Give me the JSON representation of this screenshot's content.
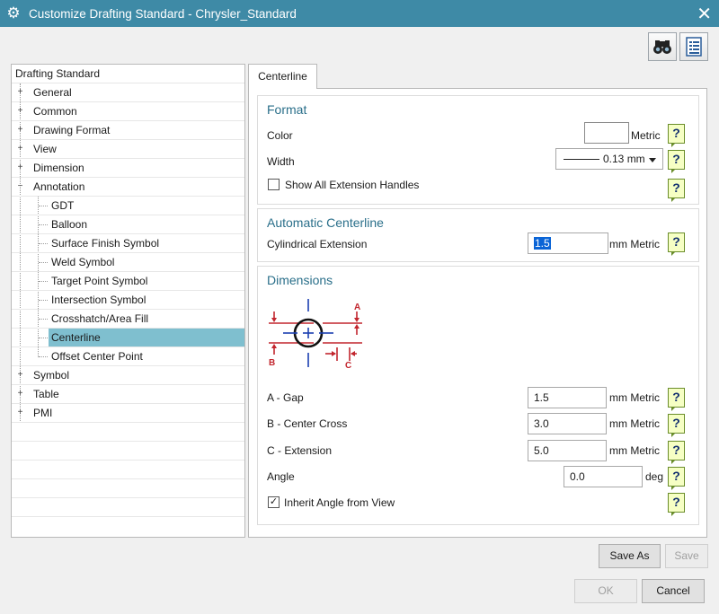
{
  "window": {
    "title": "Customize Drafting Standard - Chrysler_Standard",
    "icon": "gear-icon",
    "close": "✕"
  },
  "toolbar": {
    "find_icon": "binoculars-icon",
    "info_icon": "info-list-icon"
  },
  "tree": {
    "header": "Drafting Standard",
    "items": [
      {
        "label": "General",
        "expander": "+"
      },
      {
        "label": "Common",
        "expander": "+"
      },
      {
        "label": "Drawing Format",
        "expander": "+"
      },
      {
        "label": "View",
        "expander": "+"
      },
      {
        "label": "Dimension",
        "expander": "+"
      },
      {
        "label": "Annotation",
        "expander": "−"
      },
      {
        "label": "GDT"
      },
      {
        "label": "Balloon"
      },
      {
        "label": "Surface Finish Symbol"
      },
      {
        "label": "Weld Symbol"
      },
      {
        "label": "Target Point Symbol"
      },
      {
        "label": "Intersection Symbol"
      },
      {
        "label": "Crosshatch/Area Fill"
      },
      {
        "label": "Centerline",
        "selected": true
      },
      {
        "label": "Offset Center Point"
      },
      {
        "label": "Symbol",
        "expander": "+"
      },
      {
        "label": "Table",
        "expander": "+"
      },
      {
        "label": "PMI",
        "expander": "+"
      }
    ]
  },
  "tab": {
    "label": "Centerline"
  },
  "format": {
    "title": "Format",
    "color_label": "Color",
    "color_value": "#ffffff",
    "color_unit": "Metric",
    "width_label": "Width",
    "width_value": "0.13 mm",
    "show_handles_label": "Show All Extension Handles",
    "show_handles_checked": false
  },
  "auto_centerline": {
    "title": "Automatic Centerline",
    "cyl_ext_label": "Cylindrical Extension",
    "cyl_ext_value": "1.5",
    "cyl_ext_unit": "mm Metric"
  },
  "dimensions": {
    "title": "Dimensions",
    "diagram_labels": {
      "a": "A",
      "b": "B",
      "c": "C"
    },
    "gap_label": "A - Gap",
    "gap_value": "1.5",
    "gap_unit": "mm Metric",
    "center_cross_label": "B - Center Cross",
    "center_cross_value": "3.0",
    "center_cross_unit": "mm Metric",
    "extension_label": "C - Extension",
    "extension_value": "5.0",
    "extension_unit": "mm Metric",
    "angle_label": "Angle",
    "angle_value": "0.0",
    "angle_unit": "deg",
    "inherit_label": "Inherit Angle from View",
    "inherit_checked": true
  },
  "help_symbol": "?",
  "buttons": {
    "save_as": "Save As",
    "save": "Save",
    "ok": "OK",
    "cancel": "Cancel"
  }
}
